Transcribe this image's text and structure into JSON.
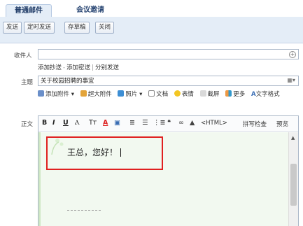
{
  "tabs": [
    {
      "label": "普通邮件"
    },
    {
      "label": "会议邀请"
    }
  ],
  "toolbar": {
    "send": "发送",
    "schedule_send": "定时发送",
    "save_draft": "存草稿",
    "close": "关闭"
  },
  "form": {
    "to_label": "收件人",
    "to_value": "",
    "add_button": "+",
    "links": {
      "cc": "添加抄送",
      "dash": "-",
      "bcc": "添加密送",
      "pipe": "|",
      "separate": "分别发送"
    },
    "subject_label": "主题",
    "subject_value": "关于校园招聘的事宜",
    "subject_menu": "▦▾",
    "attachments": {
      "add_attachment": "添加附件",
      "big_attachment": "超大附件",
      "photo": "照片",
      "document": "文档",
      "emoji": "表情",
      "screenshot": "截屏",
      "more": "更多",
      "text_format": "文字格式"
    },
    "body_label": "正文"
  },
  "editor": {
    "format_buttons": [
      "B",
      "I",
      "U",
      "Ⲁ",
      "Tт",
      "A",
      "▣",
      "≣",
      "☰",
      "⋮≣",
      "❝",
      "∞",
      "▲"
    ],
    "html_toggle": "<HTML>",
    "spell_check": "拼写检查",
    "preview": "预览",
    "body_text": "王总，您好！"
  },
  "colors": {
    "accent": "#e4edf7",
    "highlight_box": "#e02020",
    "editor_bg": "#f2f9f0"
  }
}
